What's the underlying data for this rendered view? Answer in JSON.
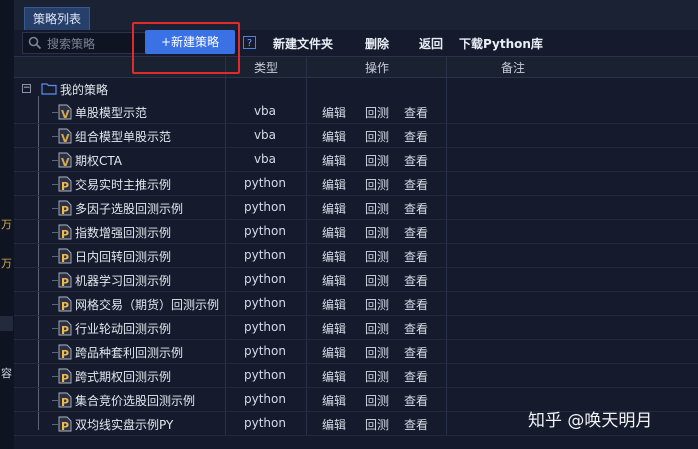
{
  "tab": {
    "label": "策略列表"
  },
  "toolbar": {
    "search_placeholder": "搜索策略",
    "new_strategy": "+新建策略",
    "help": "?",
    "new_folder": "新建文件夹",
    "delete": "删除",
    "back": "返回",
    "download": "下载Python库"
  },
  "columns": {
    "type": "类型",
    "actions": "操作",
    "notes": "备注"
  },
  "tree": {
    "root_label": "我的策略"
  },
  "actions": {
    "edit": "编辑",
    "backtest": "回测",
    "view": "查看"
  },
  "rows": [
    {
      "name": "单股模型示范",
      "type": "vba",
      "icon": "vba-file-icon"
    },
    {
      "name": "组合模型单股示范",
      "type": "vba",
      "icon": "vba-file-icon"
    },
    {
      "name": "期权CTA",
      "type": "vba",
      "icon": "vba-file-icon"
    },
    {
      "name": "交易实时主推示例",
      "type": "python",
      "icon": "python-file-icon"
    },
    {
      "name": "多因子选股回测示例",
      "type": "python",
      "icon": "python-file-icon"
    },
    {
      "name": "指数增强回测示例",
      "type": "python",
      "icon": "python-file-icon"
    },
    {
      "name": "日内回转回测示例",
      "type": "python",
      "icon": "python-file-icon"
    },
    {
      "name": "机器学习回测示例",
      "type": "python",
      "icon": "python-file-icon"
    },
    {
      "name": "网格交易（期货）回测示例",
      "type": "python",
      "icon": "python-file-icon"
    },
    {
      "name": "行业轮动回测示例",
      "type": "python",
      "icon": "python-file-icon"
    },
    {
      "name": "跨品种套利回测示例",
      "type": "python",
      "icon": "python-file-icon"
    },
    {
      "name": "跨式期权回测示例",
      "type": "python",
      "icon": "python-file-icon"
    },
    {
      "name": "集合竞价选股回测示例",
      "type": "python",
      "icon": "python-file-icon"
    },
    {
      "name": "双均线实盘示例PY",
      "type": "python",
      "icon": "python-file-icon"
    }
  ],
  "left_edge_fragments": [
    "万",
    "万",
    "容"
  ],
  "watermark": "知乎 @唤天明月",
  "colors": {
    "accent": "#3a72e6",
    "highlight_box": "#e12b2b",
    "background": "#151b2c",
    "vba_icon": "#d8a94a",
    "python_icon": "#f0b84a"
  }
}
